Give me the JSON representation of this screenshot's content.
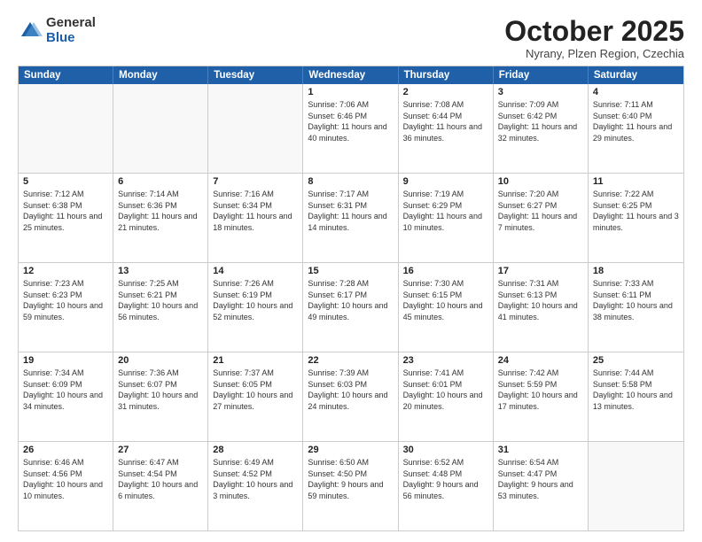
{
  "header": {
    "logo_general": "General",
    "logo_blue": "Blue",
    "month_title": "October 2025",
    "location": "Nyrany, Plzen Region, Czechia"
  },
  "weekdays": [
    "Sunday",
    "Monday",
    "Tuesday",
    "Wednesday",
    "Thursday",
    "Friday",
    "Saturday"
  ],
  "rows": [
    [
      {
        "day": "",
        "text": ""
      },
      {
        "day": "",
        "text": ""
      },
      {
        "day": "",
        "text": ""
      },
      {
        "day": "1",
        "text": "Sunrise: 7:06 AM\nSunset: 6:46 PM\nDaylight: 11 hours and 40 minutes."
      },
      {
        "day": "2",
        "text": "Sunrise: 7:08 AM\nSunset: 6:44 PM\nDaylight: 11 hours and 36 minutes."
      },
      {
        "day": "3",
        "text": "Sunrise: 7:09 AM\nSunset: 6:42 PM\nDaylight: 11 hours and 32 minutes."
      },
      {
        "day": "4",
        "text": "Sunrise: 7:11 AM\nSunset: 6:40 PM\nDaylight: 11 hours and 29 minutes."
      }
    ],
    [
      {
        "day": "5",
        "text": "Sunrise: 7:12 AM\nSunset: 6:38 PM\nDaylight: 11 hours and 25 minutes."
      },
      {
        "day": "6",
        "text": "Sunrise: 7:14 AM\nSunset: 6:36 PM\nDaylight: 11 hours and 21 minutes."
      },
      {
        "day": "7",
        "text": "Sunrise: 7:16 AM\nSunset: 6:34 PM\nDaylight: 11 hours and 18 minutes."
      },
      {
        "day": "8",
        "text": "Sunrise: 7:17 AM\nSunset: 6:31 PM\nDaylight: 11 hours and 14 minutes."
      },
      {
        "day": "9",
        "text": "Sunrise: 7:19 AM\nSunset: 6:29 PM\nDaylight: 11 hours and 10 minutes."
      },
      {
        "day": "10",
        "text": "Sunrise: 7:20 AM\nSunset: 6:27 PM\nDaylight: 11 hours and 7 minutes."
      },
      {
        "day": "11",
        "text": "Sunrise: 7:22 AM\nSunset: 6:25 PM\nDaylight: 11 hours and 3 minutes."
      }
    ],
    [
      {
        "day": "12",
        "text": "Sunrise: 7:23 AM\nSunset: 6:23 PM\nDaylight: 10 hours and 59 minutes."
      },
      {
        "day": "13",
        "text": "Sunrise: 7:25 AM\nSunset: 6:21 PM\nDaylight: 10 hours and 56 minutes."
      },
      {
        "day": "14",
        "text": "Sunrise: 7:26 AM\nSunset: 6:19 PM\nDaylight: 10 hours and 52 minutes."
      },
      {
        "day": "15",
        "text": "Sunrise: 7:28 AM\nSunset: 6:17 PM\nDaylight: 10 hours and 49 minutes."
      },
      {
        "day": "16",
        "text": "Sunrise: 7:30 AM\nSunset: 6:15 PM\nDaylight: 10 hours and 45 minutes."
      },
      {
        "day": "17",
        "text": "Sunrise: 7:31 AM\nSunset: 6:13 PM\nDaylight: 10 hours and 41 minutes."
      },
      {
        "day": "18",
        "text": "Sunrise: 7:33 AM\nSunset: 6:11 PM\nDaylight: 10 hours and 38 minutes."
      }
    ],
    [
      {
        "day": "19",
        "text": "Sunrise: 7:34 AM\nSunset: 6:09 PM\nDaylight: 10 hours and 34 minutes."
      },
      {
        "day": "20",
        "text": "Sunrise: 7:36 AM\nSunset: 6:07 PM\nDaylight: 10 hours and 31 minutes."
      },
      {
        "day": "21",
        "text": "Sunrise: 7:37 AM\nSunset: 6:05 PM\nDaylight: 10 hours and 27 minutes."
      },
      {
        "day": "22",
        "text": "Sunrise: 7:39 AM\nSunset: 6:03 PM\nDaylight: 10 hours and 24 minutes."
      },
      {
        "day": "23",
        "text": "Sunrise: 7:41 AM\nSunset: 6:01 PM\nDaylight: 10 hours and 20 minutes."
      },
      {
        "day": "24",
        "text": "Sunrise: 7:42 AM\nSunset: 5:59 PM\nDaylight: 10 hours and 17 minutes."
      },
      {
        "day": "25",
        "text": "Sunrise: 7:44 AM\nSunset: 5:58 PM\nDaylight: 10 hours and 13 minutes."
      }
    ],
    [
      {
        "day": "26",
        "text": "Sunrise: 6:46 AM\nSunset: 4:56 PM\nDaylight: 10 hours and 10 minutes."
      },
      {
        "day": "27",
        "text": "Sunrise: 6:47 AM\nSunset: 4:54 PM\nDaylight: 10 hours and 6 minutes."
      },
      {
        "day": "28",
        "text": "Sunrise: 6:49 AM\nSunset: 4:52 PM\nDaylight: 10 hours and 3 minutes."
      },
      {
        "day": "29",
        "text": "Sunrise: 6:50 AM\nSunset: 4:50 PM\nDaylight: 9 hours and 59 minutes."
      },
      {
        "day": "30",
        "text": "Sunrise: 6:52 AM\nSunset: 4:48 PM\nDaylight: 9 hours and 56 minutes."
      },
      {
        "day": "31",
        "text": "Sunrise: 6:54 AM\nSunset: 4:47 PM\nDaylight: 9 hours and 53 minutes."
      },
      {
        "day": "",
        "text": ""
      }
    ]
  ]
}
